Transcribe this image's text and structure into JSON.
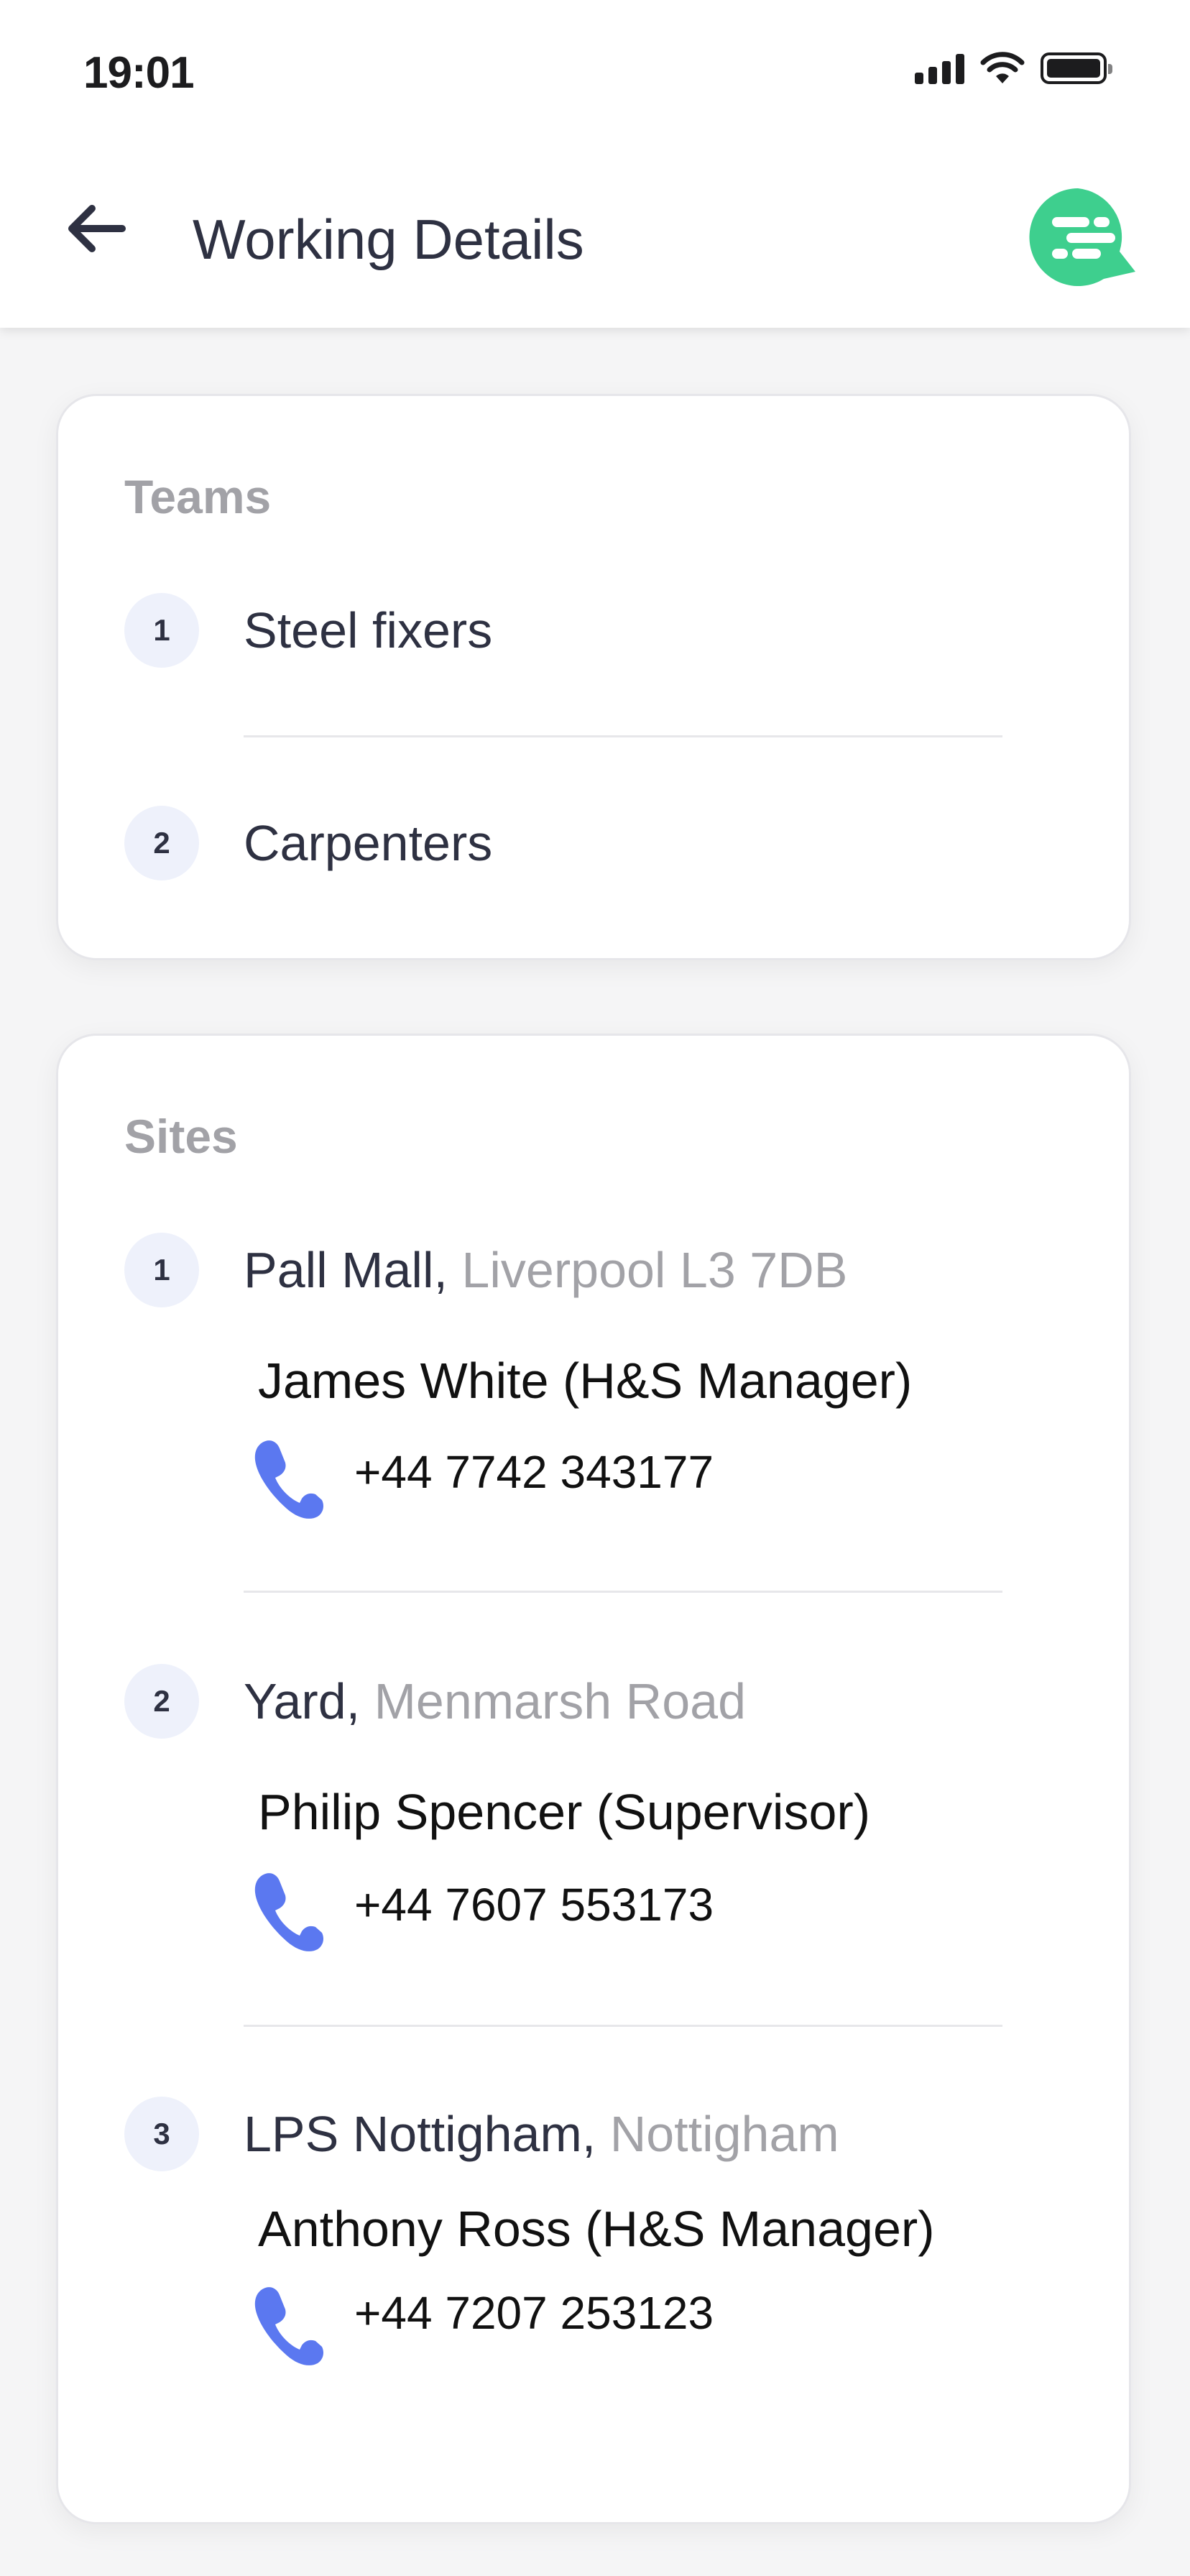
{
  "status_bar": {
    "time": "19:01",
    "icons": [
      "signal-icon",
      "wifi-icon",
      "battery-icon"
    ]
  },
  "header": {
    "back_icon": "arrow-left-icon",
    "title": "Working Details",
    "logo_icon": "chat-logo-icon"
  },
  "teams": {
    "title": "Teams",
    "items": [
      {
        "number": "1",
        "name": "Steel fixers"
      },
      {
        "number": "2",
        "name": "Carpenters"
      }
    ]
  },
  "sites": {
    "title": "Sites",
    "items": [
      {
        "number": "1",
        "name": "Pall Mall,",
        "location": " Liverpool L3 7DB",
        "contact": "James White (H&S Manager)",
        "phone": "+44 7742 343177"
      },
      {
        "number": "2",
        "name": "Yard,",
        "location": " Menmarsh Road",
        "contact": "Philip Spencer (Supervisor)",
        "phone": "+44 7607 553173"
      },
      {
        "number": "3",
        "name": "LPS Nottigham,",
        "location": " Nottigham",
        "contact": "Anthony Ross (H&S Manager)",
        "phone": "+44 7207 253123"
      }
    ]
  },
  "colors": {
    "accent_green": "#3ecf8e",
    "phone_blue": "#5b78f0",
    "muted_text": "#a2a2a7",
    "badge_bg": "#eef1fb"
  }
}
